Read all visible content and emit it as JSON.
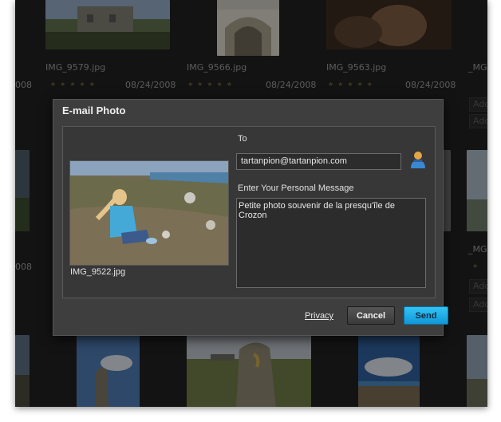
{
  "grid": {
    "row1": [
      {
        "filename": "IMG_9579.jpg",
        "date": "08/24/2008"
      },
      {
        "filename": "IMG_9566.jpg",
        "date": "08/24/2008"
      },
      {
        "filename": "IMG_9563.jpg",
        "date": "08/24/2008"
      },
      {
        "filename": "_MG",
        "date": ""
      }
    ],
    "edge_date_left": "008",
    "edge_date_left_2": "008",
    "edge_filename_right_2": "_MG",
    "add_labels": [
      "Add",
      "Add",
      "Add",
      "Add"
    ],
    "stars": "★★★★★",
    "star_single": "★"
  },
  "dialog": {
    "title": "E-mail Photo",
    "preview_filename": "IMG_9522.jpg",
    "to_label": "To",
    "to_value": "tartanpion@tartanpion.com",
    "message_label": "Enter Your Personal Message",
    "message_value": "Petite photo souvenir de la presqu'île de Crozon",
    "privacy_link": "Privacy",
    "cancel_label": "Cancel",
    "send_label": "Send",
    "contacts_icon": "address-book-person-icon"
  },
  "colors": {
    "accent": "#1aa8e8",
    "stars": "#6b5e35",
    "background": "#202020"
  }
}
